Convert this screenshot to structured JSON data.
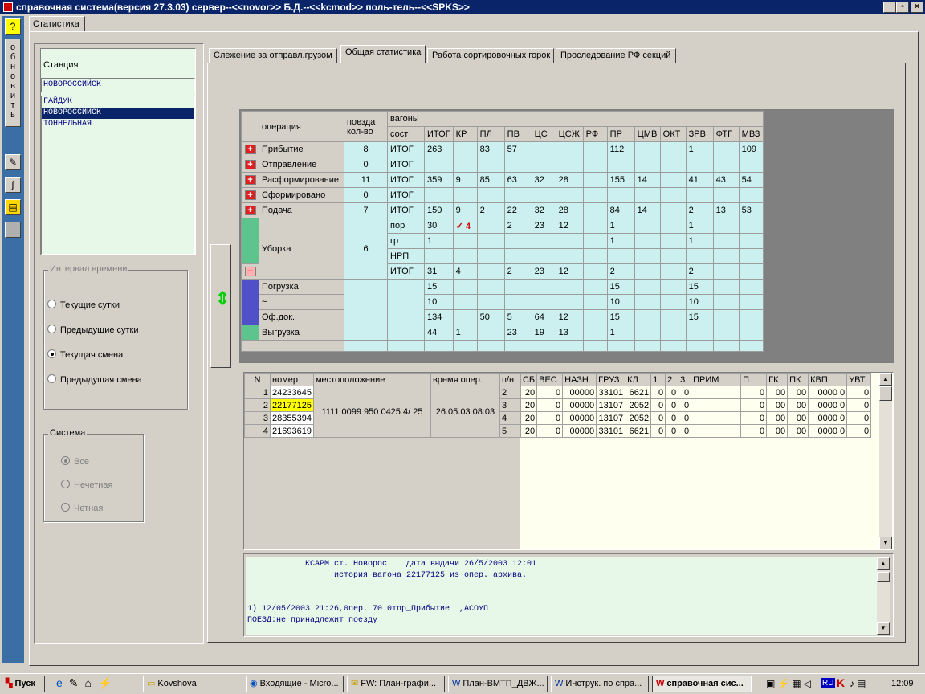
{
  "window": {
    "title": "справочная система(версия 27.3.03) сервер--<<novor>> Б.Д.--<<kcmod>> поль-тель--<<SPKS>>"
  },
  "outer_tab": "Статистика",
  "refresh_label": "обновить",
  "station": {
    "label": "Станция",
    "value": "НОВОРОССИЙСК",
    "list": [
      "ГАЙДУК",
      "НОВОРОССИЙСК",
      "ТОННЕЛЬНАЯ"
    ],
    "selected": 1
  },
  "interval": {
    "label": "Интервал времени",
    "options": [
      "Текущие сутки",
      "Предыдущие сутки",
      "Текущая смена",
      "Предыдущая смена"
    ],
    "selected": 2
  },
  "system": {
    "label": "Система",
    "options": [
      "Все",
      "Нечетная",
      "Четная"
    ],
    "selected": 0
  },
  "tabs": [
    "Слежение за отправл.грузом",
    "Общая статистика",
    "Работа сортировочных горок",
    "Проследование РФ секций"
  ],
  "active_tab": 1,
  "stats": {
    "h_operation": "операция",
    "h_trains": "поезда",
    "h_trains_count": "кол-во",
    "h_wagons": "вагоны",
    "h_sost": "сост",
    "columns": [
      "ИТОГ",
      "КР",
      "ПЛ",
      "ПВ",
      "ЦС",
      "ЦСЖ",
      "РФ",
      "ПР",
      "ЦМВ",
      "ОКТ",
      "ЗРВ",
      "ФТГ",
      "МВЗ"
    ],
    "rows": [
      {
        "op": "Прибытие",
        "trains": "8",
        "sost": "ИТОГ",
        "vals": [
          "263",
          "",
          "83",
          "57",
          "",
          "",
          "",
          "112",
          "",
          "",
          "1",
          "",
          "109"
        ]
      },
      {
        "op": "Отправление",
        "trains": "0",
        "sost": "ИТОГ",
        "vals": [
          "",
          "",
          "",
          "",
          "",
          "",
          "",
          "",
          "",
          "",
          "",
          "",
          ""
        ]
      },
      {
        "op": "Расформирование",
        "trains": "11",
        "sost": "ИТОГ",
        "vals": [
          "359",
          "9",
          "85",
          "63",
          "32",
          "28",
          "",
          "155",
          "14",
          "",
          "41",
          "43",
          "54"
        ]
      },
      {
        "op": "Сформировано",
        "trains": "0",
        "sost": "ИТОГ",
        "vals": [
          "",
          "",
          "",
          "",
          "",
          "",
          "",
          "",
          "",
          "",
          "",
          "",
          ""
        ]
      },
      {
        "op": "Подача",
        "trains": "7",
        "sost": "ИТОГ",
        "vals": [
          "150",
          "9",
          "2",
          "22",
          "32",
          "28",
          "",
          "84",
          "14",
          "",
          "2",
          "13",
          "53"
        ]
      }
    ],
    "uborka": {
      "op": "Уборка",
      "trains": "6",
      "rows": [
        {
          "sost": "пор",
          "vals": [
            "30",
            "✓ 4",
            "",
            "2",
            "23",
            "12",
            "",
            "1",
            "",
            "",
            "1",
            "",
            ""
          ]
        },
        {
          "sost": "гр",
          "vals": [
            "1",
            "",
            "",
            "",
            "",
            "",
            "",
            "1",
            "",
            "",
            "1",
            "",
            ""
          ]
        },
        {
          "sost": "НРП",
          "vals": [
            "",
            "",
            "",
            "",
            "",
            "",
            "",
            "",
            "",
            "",
            "",
            "",
            ""
          ]
        },
        {
          "sost": "ИТОГ",
          "vals": [
            "31",
            "4",
            "",
            "2",
            "23",
            "12",
            "",
            "2",
            "",
            "",
            "2",
            "",
            ""
          ]
        }
      ]
    },
    "pogruzka": [
      {
        "op": "Погрузка",
        "vals": [
          "15",
          "",
          "",
          "",
          "",
          "",
          "",
          "15",
          "",
          "",
          "15",
          "",
          ""
        ]
      },
      {
        "op": "~",
        "vals": [
          "10",
          "",
          "",
          "",
          "",
          "",
          "",
          "10",
          "",
          "",
          "10",
          "",
          ""
        ]
      },
      {
        "op": "Оф.док.",
        "vals": [
          "134",
          "",
          "50",
          "5",
          "64",
          "12",
          "",
          "15",
          "",
          "",
          "15",
          "",
          ""
        ]
      }
    ],
    "vygruzka": {
      "op": "Выгрузка",
      "vals": [
        "44",
        "1",
        "",
        "23",
        "19",
        "13",
        "",
        "1",
        "",
        "",
        "",
        "",
        ""
      ]
    }
  },
  "wagons": {
    "headers": [
      "N",
      "номер",
      "местоположение",
      "время опер.",
      "п/н",
      "СБ",
      "ВЕС",
      "НАЗН",
      "ГРУЗ",
      "КЛ",
      "1",
      "2",
      "3",
      "ПРИМ",
      "П",
      "ГК",
      "ПК",
      "КВП",
      "УВТ"
    ],
    "location": "1111 0099 950 0425  4/ 25",
    "time": "26.05.03 08:03",
    "rows": [
      {
        "n": "1",
        "num": "24233645",
        "pn": "2",
        "sb": "20",
        "ves": "0",
        "nazn": "00000",
        "gruz": "33101",
        "kl": "6621",
        "c1": "0",
        "c2": "0",
        "c3": "0",
        "prim": "",
        "p": "0",
        "gk": "00",
        "pk": "00",
        "kvp": "0000 0",
        "uvt": "0"
      },
      {
        "n": "2",
        "num": "22177125",
        "pn": "3",
        "sb": "20",
        "ves": "0",
        "nazn": "00000",
        "gruz": "13107",
        "kl": "2052",
        "c1": "0",
        "c2": "0",
        "c3": "0",
        "prim": "",
        "p": "0",
        "gk": "00",
        "pk": "00",
        "kvp": "0000 0",
        "uvt": "0"
      },
      {
        "n": "3",
        "num": "28355394",
        "pn": "4",
        "sb": "20",
        "ves": "0",
        "nazn": "00000",
        "gruz": "13107",
        "kl": "2052",
        "c1": "0",
        "c2": "0",
        "c3": "0",
        "prim": "",
        "p": "0",
        "gk": "00",
        "pk": "00",
        "kvp": "0000 0",
        "uvt": "0"
      },
      {
        "n": "4",
        "num": "21693619",
        "pn": "5",
        "sb": "20",
        "ves": "0",
        "nazn": "00000",
        "gruz": "33101",
        "kl": "6621",
        "c1": "0",
        "c2": "0",
        "c3": "0",
        "prim": "",
        "p": "0",
        "gk": "00",
        "pk": "00",
        "kvp": "0000 0",
        "uvt": "0"
      }
    ]
  },
  "history": {
    "lines": [
      "            КСАРМ ст. Новорос    дата выдачи 26/5/2003 12:01",
      "                  история вагона 22177125 из опер. архива.",
      "",
      "",
      "1) 12/05/2003 21:26,0пер. 70 0тпр_Прибытие  ,АСОУП",
      "ПОЕЗД:не принадлежит поезду"
    ]
  },
  "taskbar": {
    "start": "Пуск",
    "items": [
      "Kovshova",
      "Входящие - Micro...",
      "FW: План-графи...",
      "План-ВМТП_ДВЖ...",
      "Инструк. по спра...",
      "справочная сис..."
    ],
    "active": 5,
    "lang": "RU",
    "clock": "12:09"
  }
}
